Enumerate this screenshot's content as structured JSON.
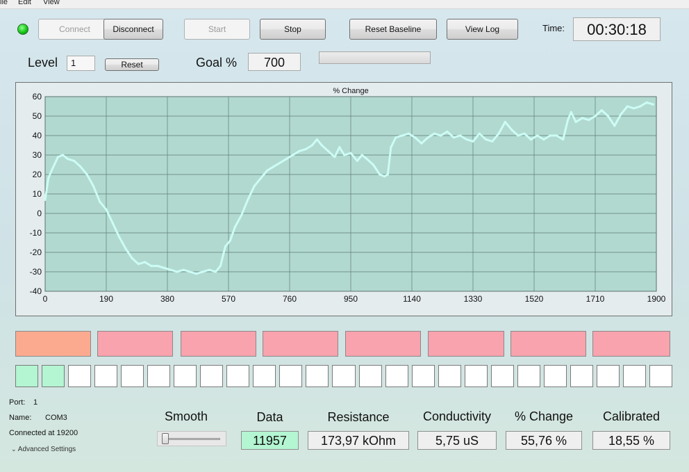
{
  "menu": {
    "items": [
      "ile",
      "Edit",
      "View"
    ]
  },
  "toolbar": {
    "connect_label": "Connect",
    "disconnect_label": "Disconnect",
    "start_label": "Start",
    "stop_label": "Stop",
    "reset_baseline_label": "Reset Baseline",
    "view_log_label": "View Log",
    "time_label": "Time:",
    "time_value": "00:30:18",
    "connection_led_color": "#14c814"
  },
  "level": {
    "label": "Level",
    "value": "1",
    "reset_label": "Reset"
  },
  "goal": {
    "label": "Goal %",
    "value": "700",
    "progress": 0
  },
  "chart_data": {
    "type": "line",
    "title": "% Change",
    "xlabel": "",
    "ylabel": "",
    "xlim": [
      0,
      1900
    ],
    "ylim": [
      -40,
      60
    ],
    "xticks": [
      0,
      190,
      380,
      570,
      760,
      950,
      1140,
      1330,
      1520,
      1710,
      1900
    ],
    "yticks": [
      60,
      50,
      40,
      30,
      20,
      10,
      0,
      -10,
      -20,
      -30,
      -40
    ],
    "grid": true,
    "background": "#b1d9d0",
    "line_color": "#ccfcf5",
    "series": [
      {
        "x": [
          0,
          10,
          20,
          40,
          55,
          70,
          90,
          110,
          130,
          150,
          170,
          190,
          210,
          230,
          250,
          270,
          290,
          310,
          330,
          350,
          370,
          390,
          410,
          430,
          450,
          470,
          490,
          510,
          530,
          545,
          560,
          575,
          590,
          610,
          630,
          650,
          670,
          690,
          710,
          730,
          750,
          770,
          790,
          810,
          830,
          845,
          860,
          880,
          900,
          915,
          930,
          950,
          970,
          985,
          1000,
          1020,
          1040,
          1055,
          1065,
          1075,
          1090,
          1110,
          1130,
          1150,
          1170,
          1190,
          1210,
          1230,
          1250,
          1270,
          1290,
          1310,
          1330,
          1350,
          1370,
          1390,
          1410,
          1430,
          1450,
          1470,
          1490,
          1510,
          1530,
          1550,
          1570,
          1590,
          1610,
          1625,
          1635,
          1650,
          1670,
          1690,
          1710,
          1730,
          1750,
          1770,
          1790,
          1810,
          1830,
          1850,
          1870,
          1890
        ],
        "y": [
          7,
          18,
          22,
          29,
          30,
          28,
          27,
          24,
          20,
          14,
          6,
          2,
          -5,
          -12,
          -18,
          -23,
          -26,
          -25,
          -27,
          -27,
          -28,
          -29,
          -30,
          -29,
          -30,
          -31,
          -30,
          -29,
          -30,
          -27,
          -17,
          -14,
          -7,
          -1,
          7,
          14,
          18,
          22,
          24,
          26,
          28,
          30,
          32,
          33,
          35,
          38,
          35,
          32,
          29,
          34,
          30,
          31,
          27,
          30,
          28,
          25,
          20,
          19,
          20,
          34,
          39,
          40,
          41,
          39,
          36,
          39,
          41,
          40,
          42,
          39,
          40,
          38,
          37,
          41,
          38,
          37,
          41,
          47,
          43,
          40,
          41,
          38,
          40,
          38,
          40,
          40,
          38,
          48,
          52,
          47,
          49,
          48,
          50,
          53,
          50,
          45,
          51,
          55,
          54,
          55,
          57,
          56
        ]
      }
    ]
  },
  "level_blocks": {
    "count": 8,
    "active_color": "#fbaa90",
    "inactive_color": "#f8a3ad",
    "active": 1
  },
  "progress_squares": {
    "count": 25,
    "filled": 2,
    "filled_color": "#b4f5d2",
    "empty_color": "#ffffff"
  },
  "port_info": {
    "port_label": "Port:",
    "port_value": "1",
    "name_label": "Name:",
    "name_value": "COM3",
    "connected_text": "Connected at 19200",
    "advanced_label": "Advanced Settings"
  },
  "smooth": {
    "label": "Smooth",
    "value": 0
  },
  "readouts": {
    "data_title": "Data",
    "data_value": "11957",
    "data_color": "#b4f5d2",
    "resistance_title": "Resistance",
    "resistance_value": "173,97 kOhm",
    "conductivity_title": "Conductivity",
    "conductivity_value": "5,75 uS",
    "change_title": "% Change",
    "change_value": "55,76 %",
    "calibrated_title": "Calibrated",
    "calibrated_value": "18,55 %"
  }
}
